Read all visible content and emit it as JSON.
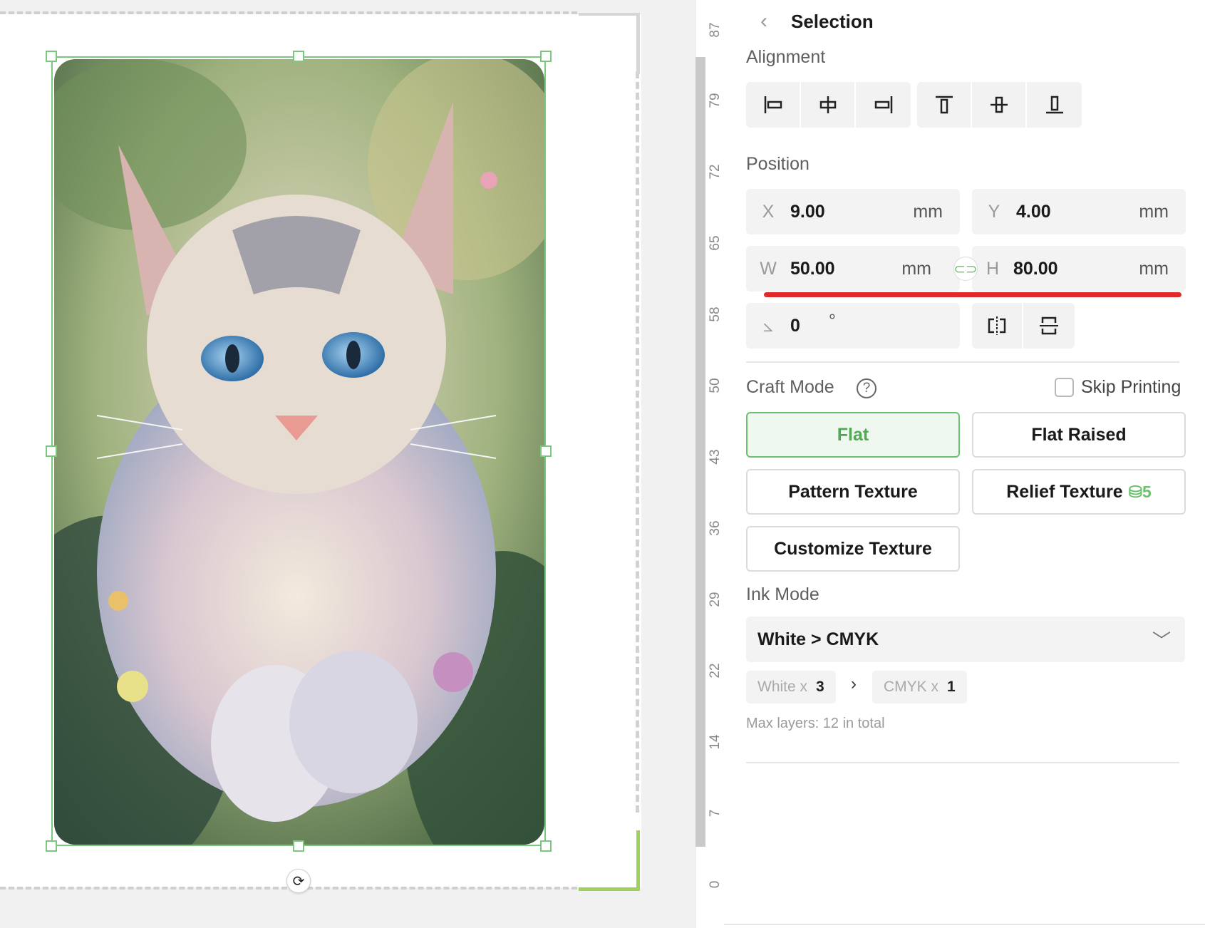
{
  "panel": {
    "title": "Selection",
    "alignment_label": "Alignment",
    "position_label": "Position",
    "fields": {
      "x": {
        "label": "X",
        "value": "9.00",
        "unit": "mm"
      },
      "y": {
        "label": "Y",
        "value": "4.00",
        "unit": "mm"
      },
      "w": {
        "label": "W",
        "value": "50.00",
        "unit": "mm"
      },
      "h": {
        "label": "H",
        "value": "80.00",
        "unit": "mm"
      },
      "rotation": {
        "value": "0",
        "unit": "°"
      }
    },
    "craft_mode": {
      "label": "Craft Mode",
      "skip_printing": "Skip Printing",
      "buttons": {
        "flat": "Flat",
        "flat_raised": "Flat Raised",
        "pattern_texture": "Pattern Texture",
        "relief_texture": "Relief Texture",
        "relief_badge": "5",
        "customize_texture": "Customize Texture"
      },
      "selected": "Flat"
    },
    "ink_mode": {
      "label": "Ink Mode",
      "selected": "White > CMYK",
      "white_label": "White x",
      "white_count": "3",
      "cmyk_label": "CMYK x",
      "cmyk_count": "1",
      "max_layers": "Max layers: 12 in total"
    }
  },
  "ruler": {
    "labels": [
      "87",
      "79",
      "72",
      "65",
      "58",
      "50",
      "43",
      "36",
      "29",
      "22",
      "14",
      "7",
      "0"
    ]
  },
  "colors": {
    "accent_green": "#6cc070",
    "highlight_red": "#e02a2a"
  },
  "icons": {
    "back": "chevron-left-icon",
    "link": "link-icon",
    "rotate": "rotate-icon",
    "help": "help-circle-icon",
    "dropdown": "chevron-down-icon",
    "coin": "coin-icon"
  }
}
